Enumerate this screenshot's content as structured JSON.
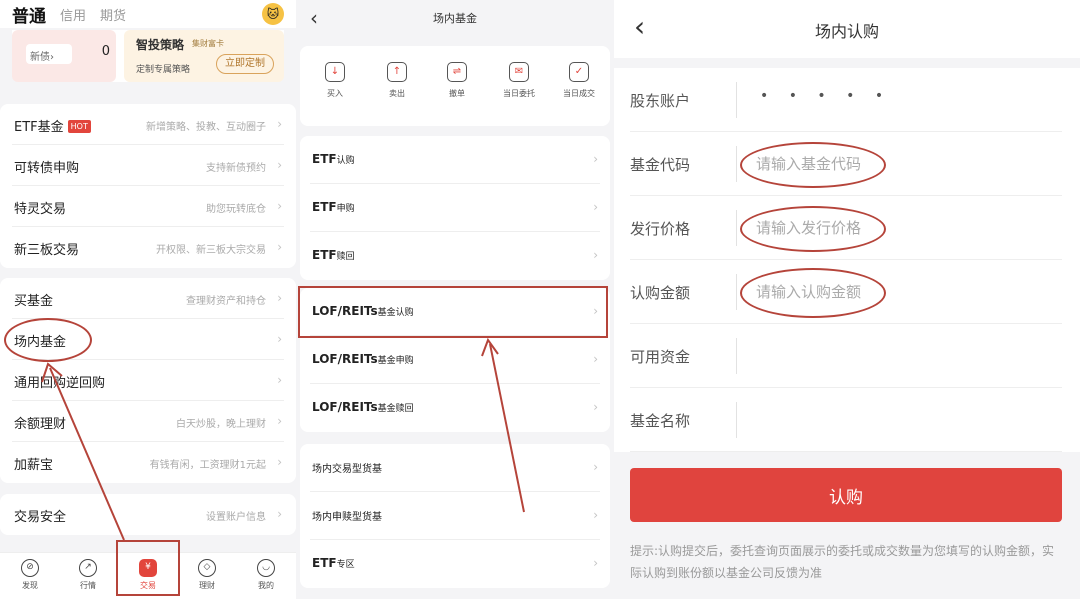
{
  "colors": {
    "accent": "#e0443e",
    "annotation": "#b5443a",
    "background": "#f4f4f6"
  },
  "panel1": {
    "top_tabs": [
      "普通",
      "信用",
      "期货"
    ],
    "mascot_icon": "cat-avatar-icon",
    "promo": {
      "xinzhai_label": "新债",
      "xinzhai_arrow": "›",
      "xinzhai_count": "0",
      "ad_title": "智投策略",
      "ad_badge": "集财富卡",
      "ad_sub": "定制专属策略",
      "ad_button": "立即定制"
    },
    "group1": [
      {
        "name": "ETF基金",
        "hot": "HOT",
        "desc": "新增策略、投教、互动圈子"
      },
      {
        "name": "可转债申购",
        "desc": "支持新债预约"
      },
      {
        "name": "特灵交易",
        "desc": "助您玩转底仓"
      },
      {
        "name": "新三板交易",
        "desc": "开权限、新三板大宗交易"
      }
    ],
    "group2": [
      {
        "name": "买基金",
        "desc": "查理财资产和持仓"
      },
      {
        "name": "场内基金",
        "desc": ""
      },
      {
        "name": "通用回购逆回购",
        "desc": ""
      },
      {
        "name": "余额理财",
        "desc": "白天炒股，晚上理财"
      },
      {
        "name": "加薪宝",
        "desc": "有钱有闲，工资理财1元起"
      }
    ],
    "group3": [
      {
        "name": "交易安全",
        "desc": "设置账户信息"
      }
    ],
    "nav": [
      {
        "label": "发现",
        "icon": "discover-icon",
        "glyph": "⊘"
      },
      {
        "label": "行情",
        "icon": "market-icon",
        "glyph": "↗"
      },
      {
        "label": "交易",
        "icon": "trade-icon",
        "glyph": "¥"
      },
      {
        "label": "理财",
        "icon": "wealth-icon",
        "glyph": "◇"
      },
      {
        "label": "我的",
        "icon": "profile-icon",
        "glyph": "◡"
      }
    ]
  },
  "panel2": {
    "title": "场内基金",
    "back": "‹",
    "actions": [
      {
        "label": "买入",
        "icon": "buy-icon",
        "glyph": "↓"
      },
      {
        "label": "卖出",
        "icon": "sell-icon",
        "glyph": "↑"
      },
      {
        "label": "撤单",
        "icon": "cancel-order-icon",
        "glyph": "⇌"
      },
      {
        "label": "当日委托",
        "icon": "today-orders-icon",
        "glyph": "✉"
      },
      {
        "label": "当日成交",
        "icon": "today-deals-icon",
        "glyph": "✓"
      }
    ],
    "group1": [
      {
        "big": "ETF",
        "sm": "认购"
      },
      {
        "big": "ETF",
        "sm": "申购"
      },
      {
        "big": "ETF",
        "sm": "赎回"
      }
    ],
    "group2": [
      {
        "big": "LOF/REITs",
        "sm": "基金认购"
      },
      {
        "big": "LOF/REITs",
        "sm": "基金申购"
      },
      {
        "big": "LOF/REITs",
        "sm": "基金赎回"
      }
    ],
    "group3": [
      {
        "plain": "场内交易型货基"
      },
      {
        "plain": "场内申赎型货基"
      },
      {
        "big": "ETF",
        "sm": "专区"
      }
    ]
  },
  "panel3": {
    "title": "场内认购",
    "back": "‹",
    "account_label": "股东账户",
    "account_value": "• • • • •",
    "rows": [
      {
        "label": "基金代码",
        "placeholder": "请输入基金代码"
      },
      {
        "label": "发行价格",
        "placeholder": "请输入发行价格"
      },
      {
        "label": "认购金额",
        "placeholder": "请输入认购金额"
      },
      {
        "label": "可用资金",
        "placeholder": ""
      },
      {
        "label": "基金名称",
        "placeholder": ""
      }
    ],
    "submit": "认购",
    "tip": "提示:认购提交后，委托查询页面展示的委托或成交数量为您填写的认购金额，实际认购到账份额以基金公司反馈为准"
  }
}
